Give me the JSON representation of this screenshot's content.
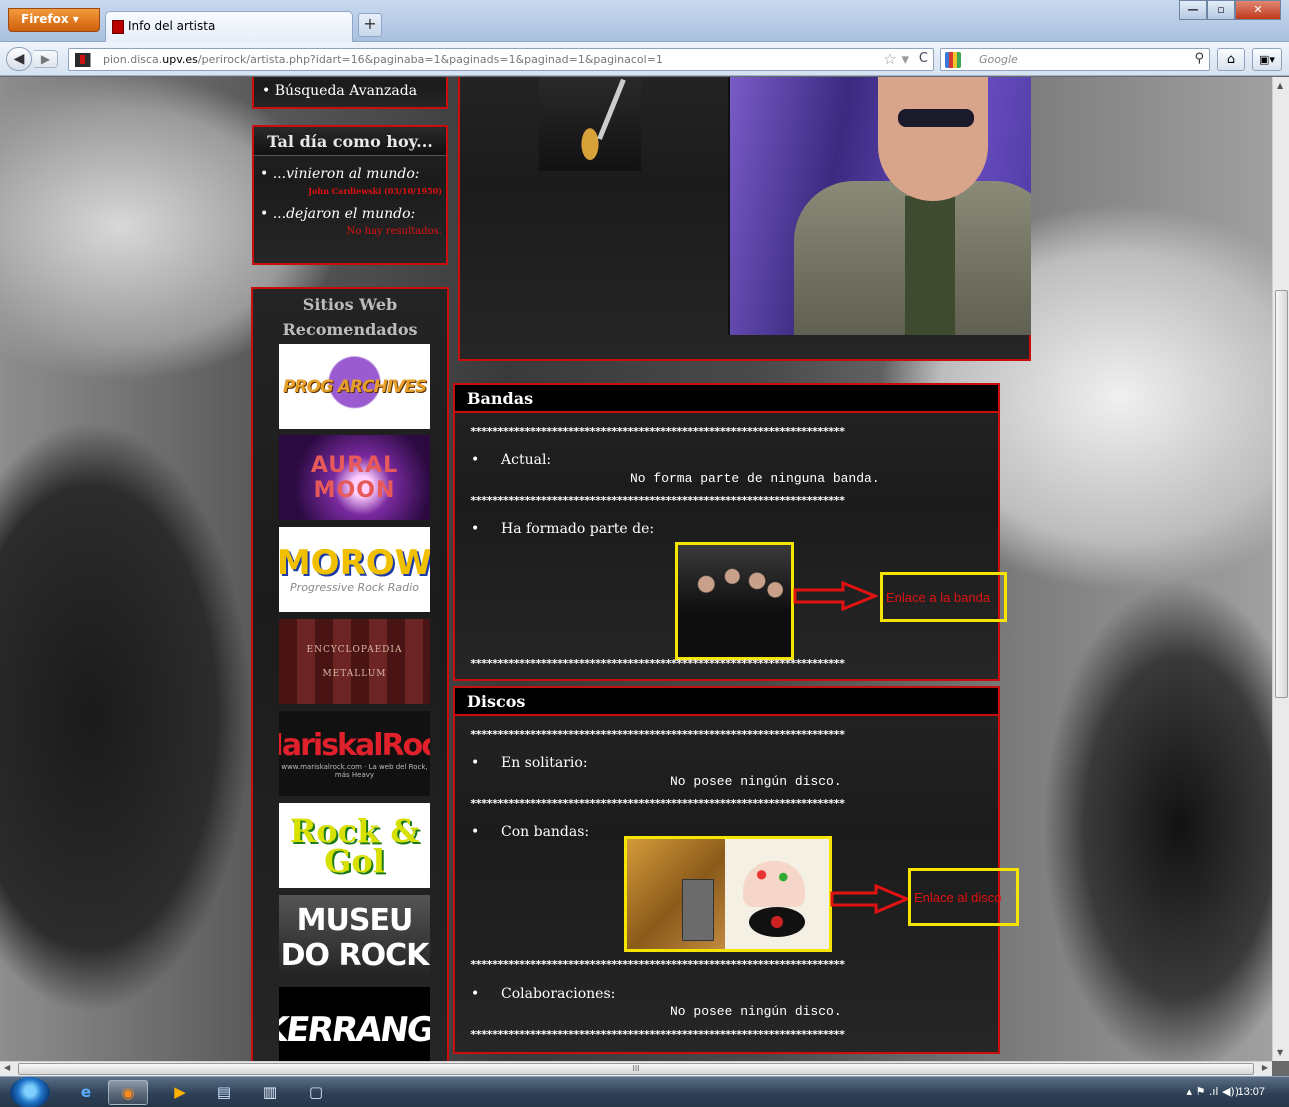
{
  "browser": {
    "app_button": "Firefox ▾",
    "tab_title": "Info del artista",
    "new_tab": "+",
    "url_prefix": "pion.disca.",
    "url_domain": "upv.es",
    "url_rest": "/perirock/artista.php?idart=16&paginaba=1&paginads=1&paginad=1&paginacol=1",
    "search_placeholder": "Google",
    "win_min": "—",
    "win_max": "▫",
    "win_close": "✕"
  },
  "sidebar": {
    "menu_item": "• Búsqueda Avanzada",
    "today": {
      "title": "Tal día como hoy...",
      "born_label": "...vinieron al mundo:",
      "born_value": "John Cardiewski (03/10/1950)",
      "died_label": "...dejaron el mundo:",
      "died_value": "No hay resultados."
    },
    "sites": {
      "title": "Sitios Web Recomendados",
      "banners": [
        {
          "label": "PROG ARCHIVES"
        },
        {
          "label": "AURAL MOON"
        },
        {
          "label": "MOROW",
          "sub": "Progressive Rock Radio"
        },
        {
          "label": "ENCYCLOPAEDIA METALLUM"
        },
        {
          "label": "MariskalRock",
          "sub": "www.mariskalrock.com · La web del Rock, más Heavy"
        },
        {
          "label": "Rock & Gol"
        },
        {
          "label": "MUSEU DO ROCK"
        },
        {
          "label": "KERRANG!"
        }
      ]
    }
  },
  "bandas": {
    "title": "Bandas",
    "stars": "*********************************************************************",
    "actual_label": "Actual:",
    "actual_value": "No forma parte de ninguna banda.",
    "past_label": "Ha formado parte de:",
    "link_label": "Enlace a la banda"
  },
  "discos": {
    "title": "Discos",
    "solo_label": "En solitario:",
    "solo_value": "No posee ningún disco.",
    "bands_label": "Con bandas:",
    "link_label": "Enlace al disco",
    "collab_label": "Colaboraciones:",
    "collab_value": "No posee ningún disco."
  },
  "scroll": {
    "up": "▲",
    "down": "▼",
    "left": "◀",
    "right": "▶",
    "grip": "III"
  },
  "taskbar": {
    "icons": [
      {
        "name": "internet-explorer-icon",
        "glyph": "e"
      },
      {
        "name": "firefox-icon",
        "glyph": "◉"
      },
      {
        "name": "media-player-icon",
        "glyph": "▶"
      },
      {
        "name": "file-explorer-icon",
        "glyph": "▤"
      },
      {
        "name": "documents-icon",
        "glyph": "▥"
      },
      {
        "name": "window-icon",
        "glyph": "▢"
      }
    ],
    "tray": "▴  ⚑  .ıl  ◀))",
    "clock": "13:07"
  },
  "colors": {
    "accent_red": "#c80f0f",
    "highlight_yellow": "#f5e400",
    "link_red": "#e01212"
  }
}
